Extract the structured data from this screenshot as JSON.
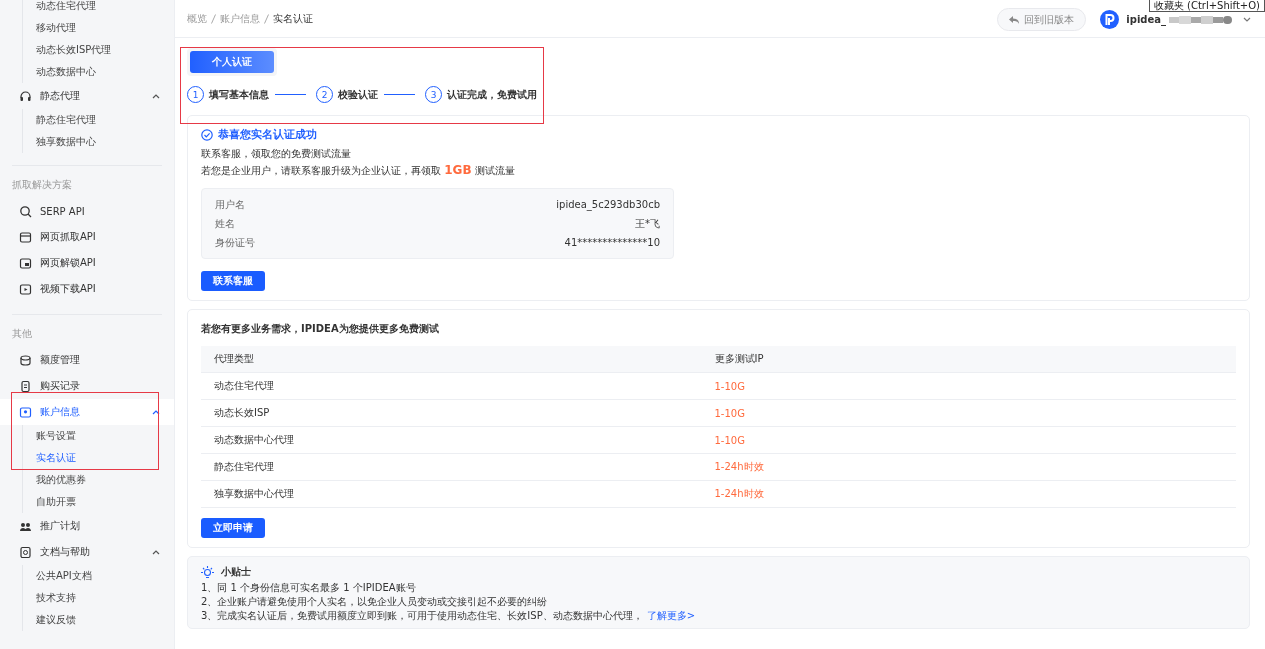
{
  "sidebar": {
    "sections": [
      {
        "entries": [
          {
            "kind": "sublist",
            "children": [
              {
                "label": "动态住宅代理",
                "selected": false
              },
              {
                "label": "移动代理",
                "selected": false
              },
              {
                "label": "动态长效ISP代理",
                "selected": false
              },
              {
                "label": "动态数据中心",
                "selected": false
              }
            ]
          },
          {
            "kind": "group",
            "label": "静态代理",
            "expanded": true,
            "selected": false,
            "children": [
              {
                "label": "静态住宅代理",
                "selected": false
              },
              {
                "label": "独享数据中心",
                "selected": false
              }
            ]
          }
        ]
      },
      {
        "heading": "抓取解决方案",
        "entries": [
          {
            "kind": "link",
            "label": "SERP API",
            "selected": false
          },
          {
            "kind": "link",
            "label": "网页抓取API",
            "selected": false
          },
          {
            "kind": "link",
            "label": "网页解锁API",
            "selected": false
          },
          {
            "kind": "link",
            "label": "视频下载API",
            "selected": false
          }
        ]
      },
      {
        "heading": "其他",
        "entries": [
          {
            "kind": "link",
            "label": "额度管理",
            "selected": false
          },
          {
            "kind": "link",
            "label": "购买记录",
            "selected": false
          },
          {
            "kind": "group",
            "label": "账户信息",
            "expanded": true,
            "selected": true,
            "children": [
              {
                "label": "账号设置",
                "selected": false
              },
              {
                "label": "实名认证",
                "selected": true
              },
              {
                "label": "我的优惠券",
                "selected": false
              },
              {
                "label": "自助开票",
                "selected": false
              }
            ]
          },
          {
            "kind": "link",
            "label": "推广计划",
            "selected": false
          },
          {
            "kind": "group",
            "label": "文档与帮助",
            "expanded": true,
            "selected": false,
            "children": [
              {
                "label": "公共API文档",
                "selected": false
              },
              {
                "label": "技术支持",
                "selected": false
              },
              {
                "label": "建议反馈",
                "selected": false
              }
            ]
          }
        ]
      }
    ]
  },
  "breadcrumb": [
    "概览",
    "账户信息",
    "实名认证"
  ],
  "header": {
    "back_button": "回到旧版本",
    "username": "ipidea_",
    "tooltip": "收藏夹 (Ctrl+Shift+O)"
  },
  "tabs": [
    {
      "label": "个人认证",
      "selected": true
    }
  ],
  "steps": [
    {
      "number": "1",
      "label": "填写基本信息"
    },
    {
      "number": "2",
      "label": "校验认证"
    },
    {
      "number": "3",
      "label": "认证完成，免费试用"
    }
  ],
  "success_card": {
    "title": "恭喜您实名认证成功",
    "line_1": "联系客服，领取您的免费测试流量",
    "line_2": {
      "before": "若您是企业用户，请联系客服升级为企业认证，再领取",
      "highlight": "1GB",
      "after": "测试流量"
    },
    "details": [
      {
        "label": "用户名",
        "value": "ipidea_5c293db30cb"
      },
      {
        "label": "姓名",
        "value": "王*飞"
      },
      {
        "label": "身份证号",
        "value": "41**************10"
      }
    ],
    "button": "联系客服"
  },
  "offer_card": {
    "title": "若您有更多业务需求，IPIDEA为您提供更多免费测试",
    "columns": [
      "代理类型",
      "更多测试IP"
    ],
    "rows": [
      [
        "动态住宅代理",
        "1-10G"
      ],
      [
        "动态长效ISP",
        "1-10G"
      ],
      [
        "动态数据中心代理",
        "1-10G"
      ],
      [
        "静态住宅代理",
        "1-24h时效"
      ],
      [
        "独享数据中心代理",
        "1-24h时效"
      ]
    ],
    "button": "立即申请"
  },
  "tips": {
    "title": "小贴士",
    "lines": [
      "1、同 1 个身份信息可实名最多 1 个IPIDEA账号",
      "2、企业账户请避免使用个人实名，以免企业人员变动或交接引起不必要的纠纷",
      "3、完成实名认证后，免费试用额度立即到账，可用于使用动态住宅、长效ISP、动态数据中心代理，"
    ],
    "link": "了解更多>"
  }
}
